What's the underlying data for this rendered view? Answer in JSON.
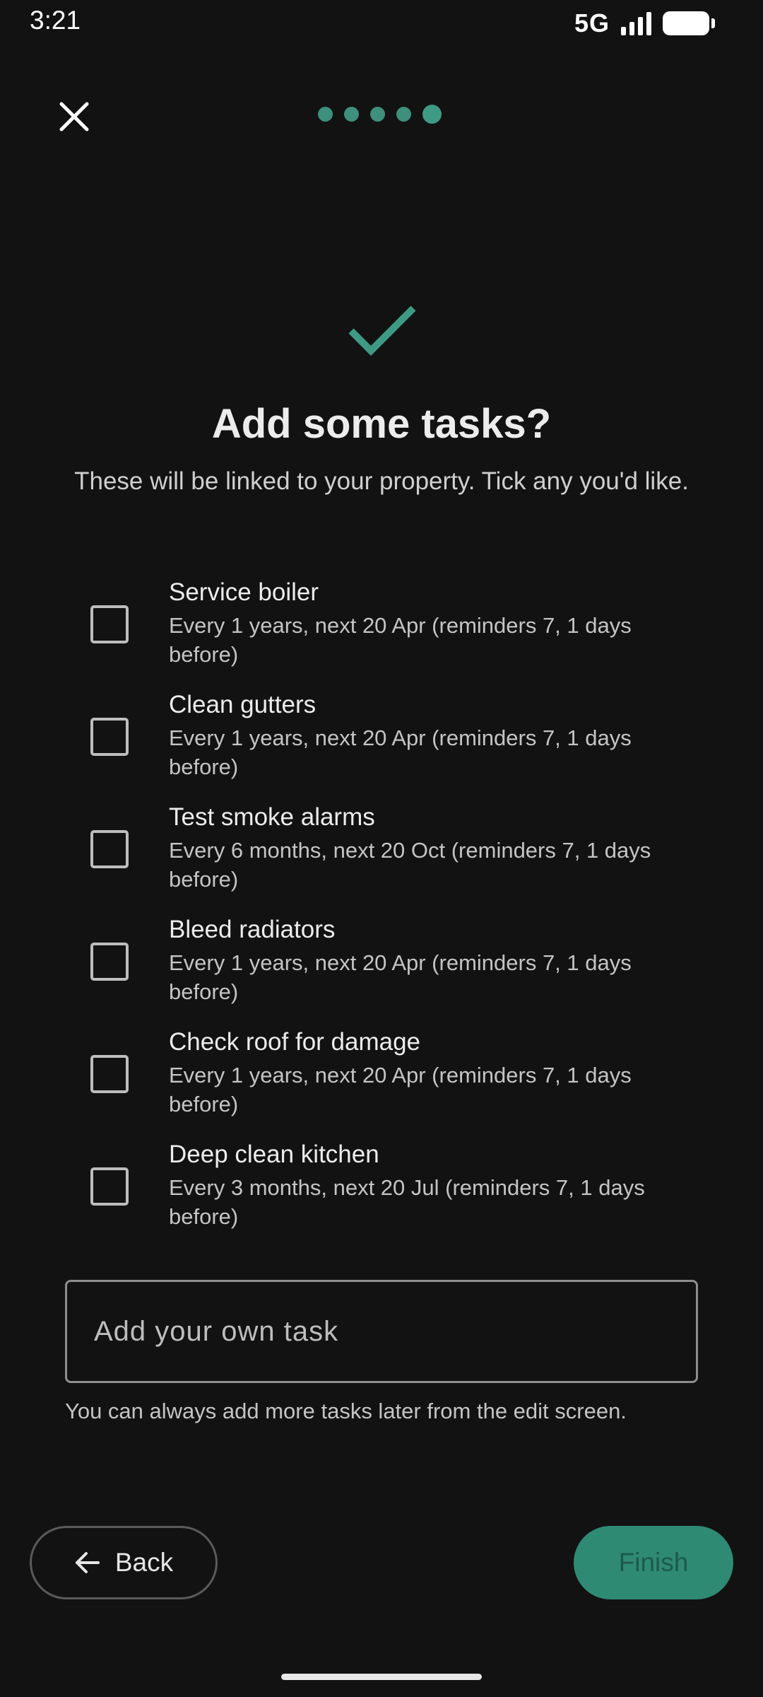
{
  "status_bar": {
    "time": "3:21",
    "network": "5G"
  },
  "header": {
    "steps_total": 5,
    "current_step": 5
  },
  "colors": {
    "accent": "#3f9a84",
    "background": "#121212",
    "finish_button": "#2f8a74"
  },
  "icons": {
    "close": "close-icon",
    "check": "check-icon",
    "back": "arrow-left-icon"
  },
  "content": {
    "title": "Add some tasks?",
    "subtitle": "These will be linked to your property. Tick any you'd like."
  },
  "tasks": [
    {
      "title": "Service boiler",
      "detail": "Every 1 years, next 20 Apr (reminders 7, 1 days before)",
      "checked": false
    },
    {
      "title": "Clean gutters",
      "detail": "Every 1 years, next 20 Apr (reminders 7, 1 days before)",
      "checked": false
    },
    {
      "title": "Test smoke alarms",
      "detail": "Every 6 months, next 20 Oct (reminders 7, 1 days before)",
      "checked": false
    },
    {
      "title": "Bleed radiators",
      "detail": "Every 1 years, next 20 Apr (reminders 7, 1 days before)",
      "checked": false
    },
    {
      "title": "Check roof for damage",
      "detail": "Every 1 years, next 20 Apr (reminders 7, 1 days before)",
      "checked": false
    },
    {
      "title": "Deep clean kitchen",
      "detail": "Every 3 months, next 20 Jul (reminders 7, 1 days before)",
      "checked": false
    }
  ],
  "own_task": {
    "placeholder": "Add your own task",
    "value": ""
  },
  "helper_text": "You can always add more tasks later from the edit screen.",
  "buttons": {
    "back_label": "Back",
    "finish_label": "Finish"
  }
}
